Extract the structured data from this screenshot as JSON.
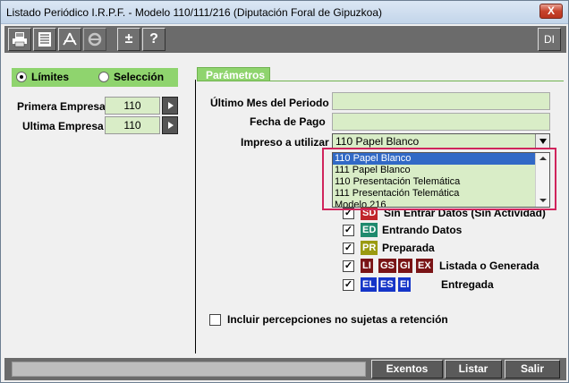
{
  "window": {
    "title": "Listado Periódico I.R.P.F. - Modelo 110/111/216 (Diputación Foral de Gipuzkoa)",
    "close_label": "X"
  },
  "toolbar": {
    "plus_minus_label": "±",
    "help_label": "?",
    "di_label": "DI"
  },
  "mode": {
    "limites_label": "Límites",
    "seleccion_label": "Selección",
    "selected": "limites"
  },
  "empresa": {
    "primera_label": "Primera Empresa",
    "primera_value": "110",
    "ultima_label": "Ultima Empresa",
    "ultima_value": "110"
  },
  "parametros": {
    "tab_label": "Parámetros",
    "ultimo_mes_label": "Último Mes del Periodo",
    "ultimo_mes_value": "",
    "fecha_pago_label": "Fecha de Pago",
    "fecha_pago_value": "",
    "impreso_label": "Impreso a utilizar",
    "impreso_value": "110 Papel Blanco",
    "impreso_options": [
      "110 Papel Blanco",
      "111 Papel Blanco",
      "110 Presentación Telemática",
      "111 Presentación Telemática",
      "Modelo 216"
    ]
  },
  "statuses": {
    "sd": {
      "badges": [
        "SD"
      ],
      "label": "Sin Entrar Datos (Sin Actividad)",
      "color": "#c0262a",
      "checked": true
    },
    "ed": {
      "badges": [
        "ED"
      ],
      "label": "Entrando Datos",
      "color": "#1f8a6e",
      "checked": true
    },
    "pr": {
      "badges": [
        "PR"
      ],
      "label": "Preparada",
      "color": "#9a9a10",
      "checked": true
    },
    "li": {
      "badges": [
        "LI",
        "GS",
        "GI",
        "EX"
      ],
      "label": "Listada o Generada",
      "color": "#7a1416",
      "checked": true
    },
    "el": {
      "badges": [
        "EL",
        "ES",
        "EI"
      ],
      "label": "Entregada",
      "color": "#1535c8",
      "checked": true
    }
  },
  "options": {
    "percepciones_label": "Incluir percepciones no sujetas a retención",
    "percepciones_checked": false
  },
  "footer": {
    "progress": 0,
    "exentos_label": "Exentos",
    "listar_label": "Listar",
    "salir_label": "Salir"
  },
  "colors": {
    "accent_green": "#8fd46e",
    "field_green": "#d9edc7",
    "toolbar_gray": "#6b6b6b",
    "highlight": "#d0245c"
  }
}
